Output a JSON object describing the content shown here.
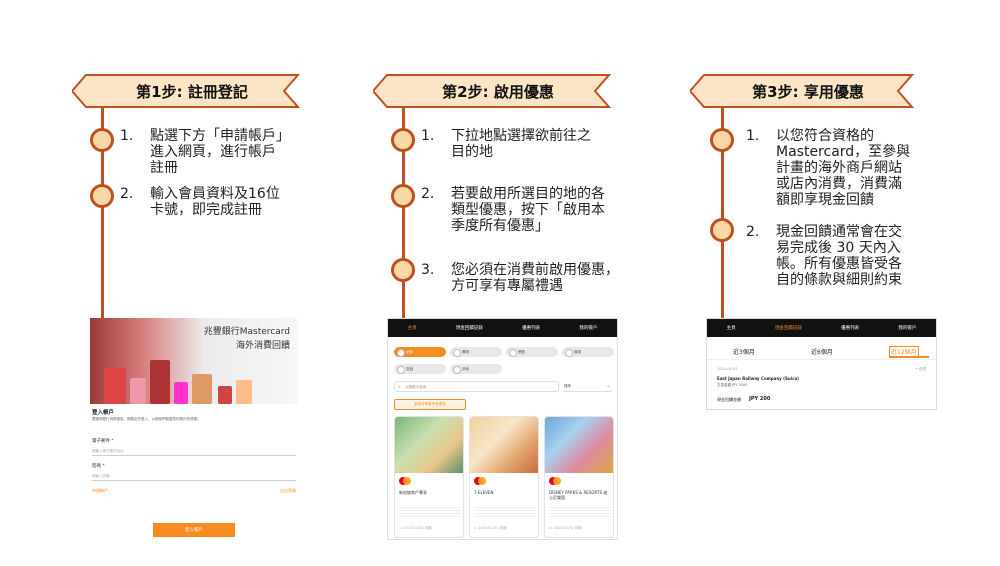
{
  "steps": [
    {
      "title": "第1步: 註冊登記",
      "items": [
        {
          "num": "1.",
          "lines": [
            "點選下方「申請帳戶」",
            "進入網頁，進行帳戶",
            "註冊"
          ]
        },
        {
          "num": "2.",
          "lines": [
            "輸入會員資料及16位",
            "卡號，即完成註冊"
          ]
        }
      ]
    },
    {
      "title": "第2步: 啟用優惠",
      "items": [
        {
          "num": "1.",
          "lines": [
            "下拉地點選擇欲前往之",
            "目的地"
          ]
        },
        {
          "num": "2.",
          "lines": [
            "若要啟用所選目的地的各",
            "類型優惠，按下「啟用本",
            "季度所有優惠」"
          ]
        },
        {
          "num": "3.",
          "lines": [
            "您必須在消費前啟用優惠，",
            "方可享有專屬禮遇"
          ]
        }
      ]
    },
    {
      "title": "第3步: 享用優惠",
      "items": [
        {
          "num": "1.",
          "lines": [
            "以您符合資格的",
            "Mastercard，至參與",
            "計畫的海外商戶網站",
            "或店內消費，消費滿",
            "額即享現金回饋"
          ]
        },
        {
          "num": "2.",
          "lines": [
            "現金回饋通常會在交",
            "易完成後 30 天內入",
            "帳。所有優惠皆受各",
            "自的條款與細則約束"
          ]
        }
      ]
    }
  ],
  "screen1": {
    "hero_title": "兆豐銀行Mastercard",
    "hero_sub": "海外消費回饋",
    "login_title": "登入帳戶",
    "login_desc": "要獲得銀行消費優惠，請務必先登入，以便我們驗證您的帳戶的資格。",
    "email_label": "電子郵件 *",
    "email_placeholder": "請輸入電子郵件地址",
    "password_label": "密碼 *",
    "password_placeholder": "請輸入密碼",
    "apply_link": "申請帳戶",
    "forgot_link": "忘記密碼",
    "login_button": "登入帳戶"
  },
  "screen2": {
    "nav": [
      "主頁",
      "現金回饋記錄",
      "優惠列表",
      "我的帳戶"
    ],
    "chips": [
      "全部",
      "購物",
      "餐飲",
      "娛樂",
      "旅遊",
      "其他"
    ],
    "search_placeholder": "以關鍵字搜尋",
    "sort_label": "排序",
    "activate_button": "啟用本季度所有優惠",
    "cards": [
      {
        "name": "新加坡商戶專享",
        "footer": "▭ 2023/12/31 到期"
      },
      {
        "name": "7-ELEVEN",
        "footer": "▭ 2023/12/31 到期"
      },
      {
        "name": "DISNEY PARKS & RESORTS 迪士尼樂園",
        "footer": "▭ 2023/12/31 到期"
      }
    ]
  },
  "screen3": {
    "nav": [
      "主頁",
      "現金回饋記錄",
      "優惠列表",
      "我的帳戶"
    ],
    "tabs": [
      "近3個月",
      "近6個月",
      "近12個月"
    ],
    "date": "2024-05-07",
    "status": "• 已付",
    "merchant": "East Japan Railway Company (Suica)",
    "txn": "交易金額 JPY 3000",
    "cashback_label": "現金回饋金額",
    "cashback_value": "JPY 200"
  },
  "colors": {
    "accent": "#c0501f",
    "chevron_fill": "#fbe5c6",
    "orange": "#f68b1f"
  }
}
